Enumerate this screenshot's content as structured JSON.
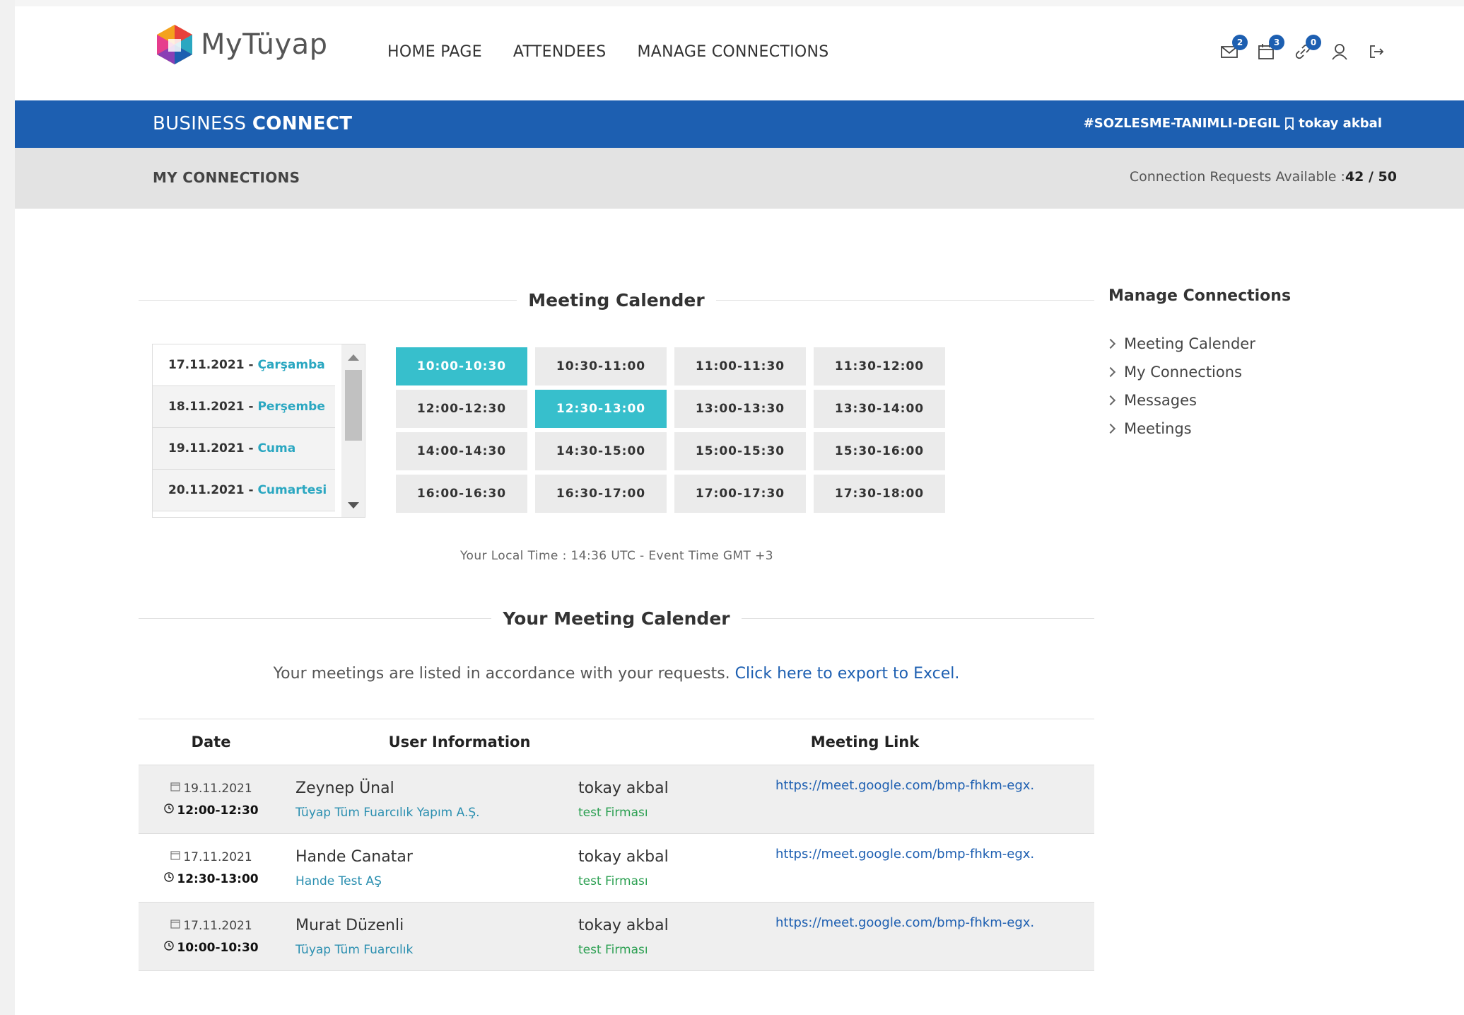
{
  "logo": {
    "text": "MyTüyap"
  },
  "nav": {
    "items": [
      "HOME PAGE",
      "ATTENDEES",
      "MANAGE CONNECTIONS"
    ]
  },
  "header_icons": {
    "messages_count": "2",
    "calendar_count": "3",
    "connections_count": "0"
  },
  "bluebar": {
    "brand_thin": "BUSINESS",
    "brand_bold": "CONNECT",
    "tag": "#SOZLESME-TANIMLI-DEGIL",
    "user": "tokay akbal"
  },
  "greybar": {
    "title": "MY CONNECTIONS",
    "requests_label": "Connection Requests Available :",
    "requests_value": "42 / 50"
  },
  "calendar": {
    "title": "Meeting Calender",
    "dates": [
      {
        "date": "17.11.2021 - ",
        "day": "Çarşamba"
      },
      {
        "date": "18.11.2021 - ",
        "day": "Perşembe"
      },
      {
        "date": "19.11.2021 - ",
        "day": "Cuma"
      },
      {
        "date": "20.11.2021 - ",
        "day": "Cumartesi"
      }
    ],
    "slots": [
      "10:00-10:30",
      "10:30-11:00",
      "11:00-11:30",
      "11:30-12:00",
      "12:00-12:30",
      "12:30-13:00",
      "13:00-13:30",
      "13:30-14:00",
      "14:00-14:30",
      "14:30-15:00",
      "15:00-15:30",
      "15:30-16:00",
      "16:00-16:30",
      "16:30-17:00",
      "17:00-17:30",
      "17:30-18:00"
    ],
    "active_slots": [
      "10:00-10:30",
      "12:30-13:00"
    ],
    "local_time": "Your Local Time : 14:36 UTC - Event Time GMT +3"
  },
  "your_calendar": {
    "title": "Your Meeting Calender",
    "listed_text": "Your meetings are listed in accordance with your requests.",
    "export_link": "Click here to export to Excel."
  },
  "table": {
    "headers": {
      "date": "Date",
      "user": "User Information",
      "link": "Meeting Link"
    },
    "rows": [
      {
        "date": "19.11.2021",
        "time": "12:00-12:30",
        "name": "Zeynep Ünal",
        "company": "Tüyap Tüm Fuarcılık Yapım A.Ş.",
        "name2": "tokay akbal",
        "company2": "test Firması",
        "link": "https://meet.google.com/bmp-fhkm-egx."
      },
      {
        "date": "17.11.2021",
        "time": "12:30-13:00",
        "name": "Hande Canatar",
        "company": "Hande Test AŞ",
        "name2": "tokay akbal",
        "company2": "test Firması",
        "link": "https://meet.google.com/bmp-fhkm-egx."
      },
      {
        "date": "17.11.2021",
        "time": "10:00-10:30",
        "name": "Murat Düzenli",
        "company": "Tüyap Tüm Fuarcılık",
        "name2": "tokay akbal",
        "company2": "test Firması",
        "link": "https://meet.google.com/bmp-fhkm-egx."
      }
    ]
  },
  "sidebar": {
    "title": "Manage Connections",
    "items": [
      "Meeting Calender",
      "My Connections",
      "Messages",
      "Meetings"
    ]
  },
  "colors": {
    "brand_blue": "#1d5fb1",
    "slot_active": "#37bfcc",
    "day_color": "#2aa7c1",
    "company_blue": "#2b8fb0",
    "company_green": "#2ca052"
  }
}
